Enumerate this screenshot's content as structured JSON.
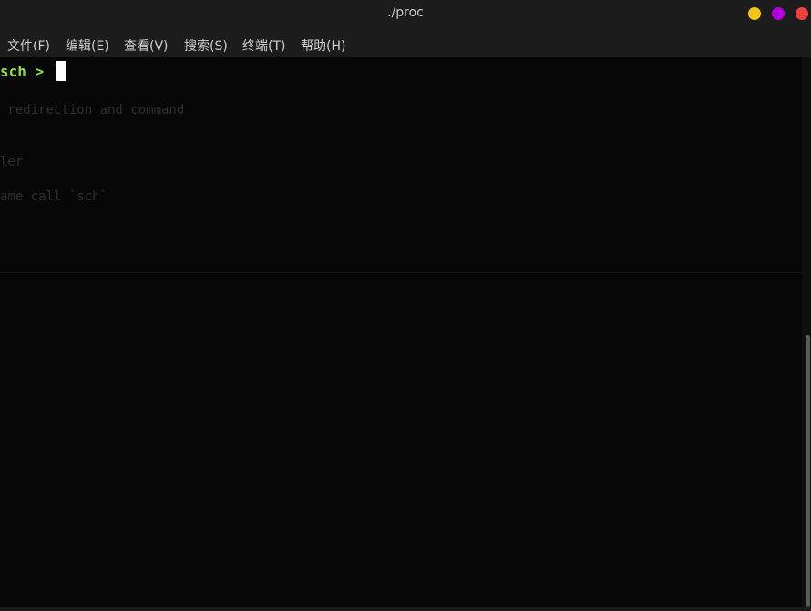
{
  "window": {
    "title": "./proc",
    "buttons": {
      "minimize_color": "#f5c518",
      "maximize_color": "#b300e0",
      "close_color": "#f04040"
    }
  },
  "menu": {
    "items": [
      {
        "label": "文件(F)"
      },
      {
        "label": "编辑(E)"
      },
      {
        "label": "查看(V)"
      },
      {
        "label": "搜索(S)"
      },
      {
        "label": "终端(T)"
      },
      {
        "label": "帮助(H)"
      }
    ]
  },
  "terminal": {
    "prompt": "sch > ",
    "prompt_color": "#8ee04a",
    "ghost_lines": [
      " redirection and command",
      "ler",
      "ame call `sch`"
    ]
  },
  "scrollbar": {
    "position_fraction": 0.5
  }
}
